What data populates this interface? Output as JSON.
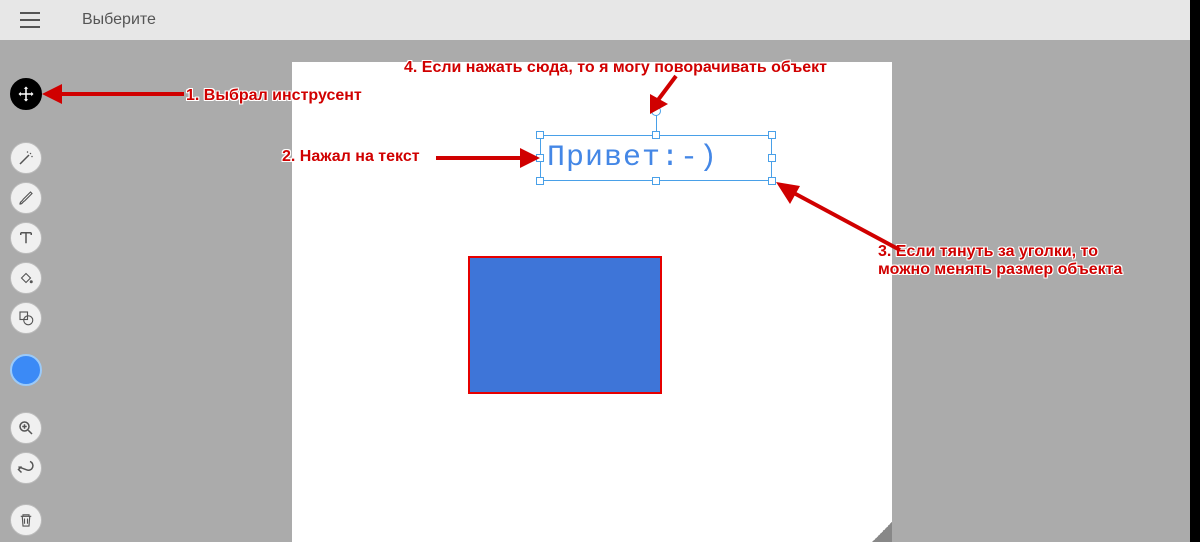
{
  "header": {
    "title": "Выберите"
  },
  "toolbar": {
    "move_name": "move-tool",
    "magic_name": "magic-wand-tool",
    "brush_name": "brush-tool",
    "text_name": "text-tool",
    "fill_name": "fill-tool",
    "shapes_name": "shapes-tool",
    "color_name": "color-swatch",
    "zoom_name": "zoom-tool",
    "undo_name": "undo-button",
    "trash_name": "delete-button"
  },
  "canvas": {
    "text_object": {
      "value": "Привет:-)"
    }
  },
  "annotations": {
    "a1": "1. Выбрал инструсент",
    "a2": "2. Нажал на текст",
    "a3_line1": "3. Если тянуть за уголки, то",
    "a3_line2": "можно менять размер объекта",
    "a4": "4. Если нажать сюда, то я могу поворачивать объект"
  },
  "colors": {
    "annotation": "#d00000",
    "swatch": "#3b8af6",
    "rect_fill": "#3e75d8",
    "rect_border": "#e60000",
    "selection": "#49a0e8"
  }
}
